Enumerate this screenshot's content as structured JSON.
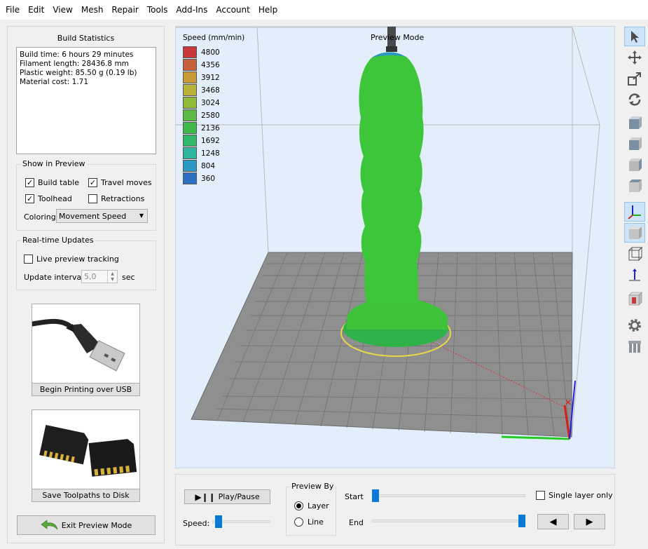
{
  "menu": [
    "File",
    "Edit",
    "View",
    "Mesh",
    "Repair",
    "Tools",
    "Add-Ins",
    "Account",
    "Help"
  ],
  "build_stats": {
    "title": "Build Statistics",
    "lines": [
      "Build time: 6 hours 29 minutes",
      "Filament length: 28436.8 mm",
      "Plastic weight: 85.50 g (0.19 lb)",
      "Material cost: 1.71"
    ]
  },
  "show_in_preview": {
    "title": "Show in Preview",
    "build_table": {
      "label": "Build table",
      "checked": true
    },
    "travel_moves": {
      "label": "Travel moves",
      "checked": true
    },
    "toolhead": {
      "label": "Toolhead",
      "checked": true
    },
    "retractions": {
      "label": "Retractions",
      "checked": false
    },
    "coloring_label": "Coloring",
    "coloring_value": "Movement Speed"
  },
  "realtime": {
    "title": "Real-time Updates",
    "live_tracking": {
      "label": "Live preview tracking",
      "checked": false
    },
    "interval_label": "Update interval",
    "interval_value": "5,0",
    "interval_unit": "sec"
  },
  "usb": {
    "label": "Begin Printing over USB"
  },
  "disk": {
    "label": "Save Toolpaths to Disk"
  },
  "exit_label": "Exit Preview Mode",
  "viewport": {
    "mode_label": "Preview Mode",
    "legend_title": "Speed (mm/min)",
    "legend": [
      {
        "value": "4800",
        "color": "#c8373a"
      },
      {
        "value": "4356",
        "color": "#c5603b"
      },
      {
        "value": "3912",
        "color": "#c69a35"
      },
      {
        "value": "3468",
        "color": "#b8b23a"
      },
      {
        "value": "3024",
        "color": "#8fba3a"
      },
      {
        "value": "2580",
        "color": "#5db743"
      },
      {
        "value": "2136",
        "color": "#3eb94a"
      },
      {
        "value": "1692",
        "color": "#33b86b"
      },
      {
        "value": "1248",
        "color": "#2fb49d"
      },
      {
        "value": "804",
        "color": "#2a98c2"
      },
      {
        "value": "360",
        "color": "#2c6ec4"
      }
    ]
  },
  "playback": {
    "play_label": "Play/Pause",
    "speed_label": "Speed:",
    "preview_by_title": "Preview By",
    "layer_label": "Layer",
    "line_label": "Line",
    "selected": "Layer",
    "start_label": "Start",
    "end_label": "End",
    "single_layer_label": "Single layer only",
    "single_layer_checked": false,
    "speed_level": 0.05,
    "start_level": 0.0,
    "end_level": 1.0
  },
  "toolbar_icons": [
    "select-arrow-icon",
    "move-icon",
    "scale-icon",
    "rotate-icon",
    "view-cube-front-icon",
    "view-cube-left-icon",
    "view-cube-right-icon",
    "view-cube-top-icon",
    "axes-icon",
    "solid-view-icon",
    "wireframe-view-icon",
    "z-axis-icon",
    "cut-box-icon",
    "settings-gear-icon",
    "supports-icon"
  ]
}
